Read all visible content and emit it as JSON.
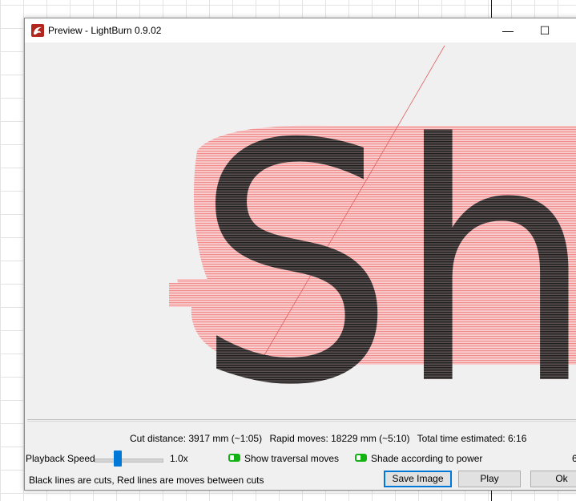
{
  "window": {
    "title": "Preview - LightBurn 0.9.02",
    "minimize_glyph": "—",
    "maximize_glyph": "☐"
  },
  "preview": {
    "text": "Sh",
    "cut_color": "#2b2b2b",
    "move_color": "#f4a3a3"
  },
  "stats": {
    "cut_distance": "Cut distance: 3917 mm (~1:05)",
    "rapid_moves": "Rapid moves: 18229 mm (~5:10)",
    "total_time": "Total time estimated: 6:16"
  },
  "playback": {
    "label": "Playback Speed",
    "value": "1.0x",
    "level": 0.35
  },
  "options": {
    "show_traversal": "Show traversal moves",
    "shade_power": "Shade according to power",
    "cutoff_text": "6"
  },
  "footer": {
    "note": "Black lines are cuts, Red lines are moves between cuts",
    "save_label": "Save Image",
    "play_label": "Play",
    "ok_label": "Ok"
  }
}
